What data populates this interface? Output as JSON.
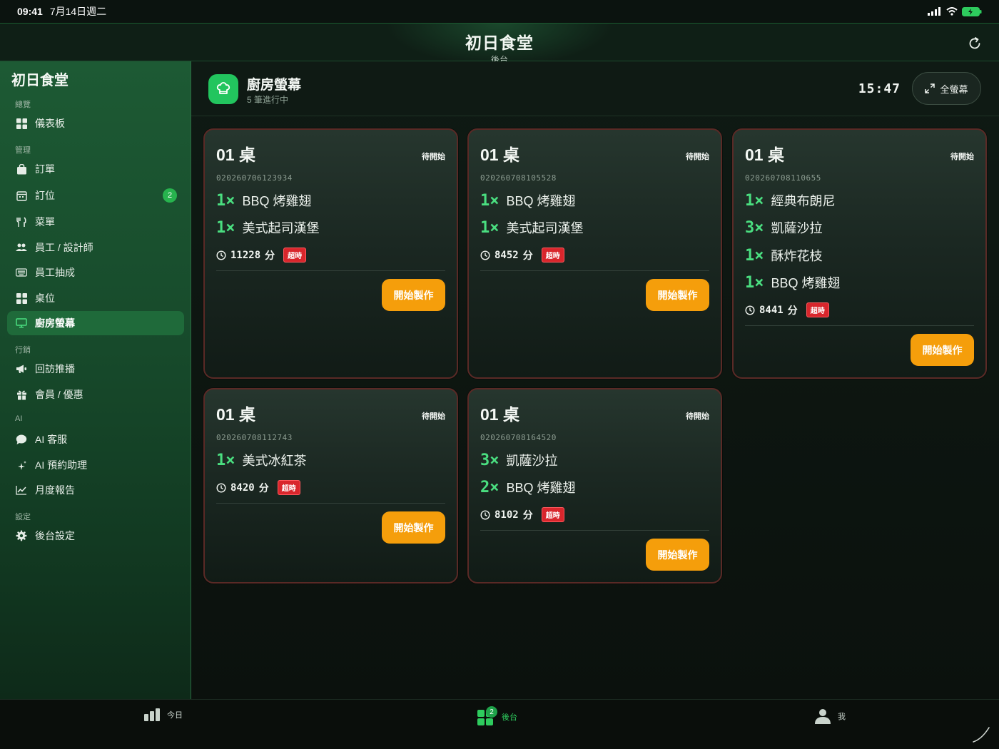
{
  "status_bar": {
    "time": "09:41",
    "date": "7月14日週二"
  },
  "header": {
    "title": "初日食堂",
    "subtitle": "後台"
  },
  "sidebar": {
    "brand": "初日食堂",
    "sections": [
      {
        "label": "總覽"
      },
      {
        "label": "管理"
      },
      {
        "label": "行銷"
      },
      {
        "label": "AI"
      },
      {
        "label": "設定"
      }
    ],
    "items": [
      {
        "label": "儀表板",
        "icon": "grid-icon"
      },
      {
        "label": "訂單",
        "icon": "bag-icon"
      },
      {
        "label": "訂位",
        "icon": "calendar-icon",
        "badge": "2"
      },
      {
        "label": "菜單",
        "icon": "utensils-icon"
      },
      {
        "label": "員工 / 設計師",
        "icon": "people-icon"
      },
      {
        "label": "員工抽成",
        "icon": "keyboard-icon"
      },
      {
        "label": "桌位",
        "icon": "grid-icon"
      },
      {
        "label": "廚房螢幕",
        "icon": "monitor-icon",
        "active": true
      },
      {
        "label": "回訪推播",
        "icon": "megaphone-icon"
      },
      {
        "label": "會員 / 優惠",
        "icon": "gift-icon"
      },
      {
        "label": "AI 客服",
        "icon": "chat-bubble-icon"
      },
      {
        "label": "AI 預約助理",
        "icon": "sparkle-icon"
      },
      {
        "label": "月度報告",
        "icon": "line-chart-icon"
      },
      {
        "label": "後台設定",
        "icon": "gear-icon"
      }
    ]
  },
  "kitchen": {
    "title": "廚房螢幕",
    "subtitle": "5 筆進行中",
    "clock": "15:47",
    "fullscreen_label": "全螢幕"
  },
  "colors": {
    "accent": "#22c55e",
    "qty": "#4ade80",
    "start_button": "#f59e0b",
    "overdue": "#d9262c",
    "card_border": "#5a2a26"
  },
  "orders": [
    {
      "table": "01 桌",
      "status": "待開始",
      "order_no": "020260706123934",
      "items": [
        {
          "qty": "1×",
          "name": "BBQ 烤雞翅"
        },
        {
          "qty": "1×",
          "name": "美式起司漢堡"
        }
      ],
      "minutes": "11228",
      "unit": "分",
      "overdue": "超時",
      "action": "開始製作"
    },
    {
      "table": "01 桌",
      "status": "待開始",
      "order_no": "020260708105528",
      "items": [
        {
          "qty": "1×",
          "name": "BBQ 烤雞翅"
        },
        {
          "qty": "1×",
          "name": "美式起司漢堡"
        }
      ],
      "minutes": "8452",
      "unit": "分",
      "overdue": "超時",
      "action": "開始製作"
    },
    {
      "table": "01 桌",
      "status": "待開始",
      "order_no": "020260708110655",
      "items": [
        {
          "qty": "1×",
          "name": "經典布朗尼"
        },
        {
          "qty": "3×",
          "name": "凱薩沙拉"
        },
        {
          "qty": "1×",
          "name": "酥炸花枝"
        },
        {
          "qty": "1×",
          "name": "BBQ 烤雞翅"
        }
      ],
      "minutes": "8441",
      "unit": "分",
      "overdue": "超時",
      "action": "開始製作"
    },
    {
      "table": "01 桌",
      "status": "待開始",
      "order_no": "020260708112743",
      "items": [
        {
          "qty": "1×",
          "name": "美式冰紅茶"
        }
      ],
      "minutes": "8420",
      "unit": "分",
      "overdue": "超時",
      "action": "開始製作"
    },
    {
      "table": "01 桌",
      "status": "待開始",
      "order_no": "020260708164520",
      "items": [
        {
          "qty": "3×",
          "name": "凱薩沙拉"
        },
        {
          "qty": "2×",
          "name": "BBQ 烤雞翅"
        }
      ],
      "minutes": "8102",
      "unit": "分",
      "overdue": "超時",
      "action": "開始製作"
    }
  ],
  "tabbar": {
    "tabs": [
      {
        "label": "今日",
        "icon": "bar-chart-icon"
      },
      {
        "label": "後台",
        "icon": "apps-icon",
        "badge": "2",
        "active": true
      },
      {
        "label": "我",
        "icon": "person-icon"
      }
    ]
  }
}
